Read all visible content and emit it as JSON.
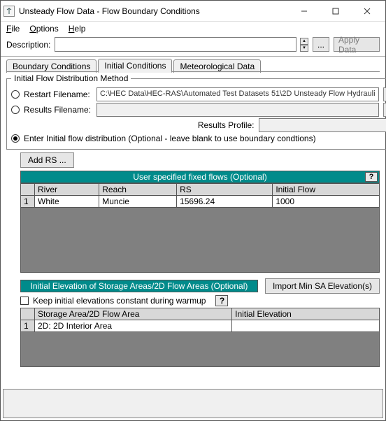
{
  "window": {
    "title": "Unsteady Flow Data - Flow Boundary Conditions"
  },
  "menu": {
    "file": "File",
    "options": "Options",
    "help": "Help"
  },
  "description": {
    "label": "Description:",
    "value": "",
    "ellipsis": "...",
    "apply": "Apply Data"
  },
  "tabs": {
    "boundary": "Boundary Conditions",
    "initial": "Initial Conditions",
    "met": "Meteorological Data"
  },
  "group": {
    "legend": "Initial Flow Distribution Method",
    "restart_label": "Restart Filename:",
    "restart_value": "C:\\HEC Data\\HEC-RAS\\Automated Test Datasets 51\\2D Unsteady Flow Hydrauli",
    "results_label": "Results Filename:",
    "results_value": "",
    "results_profile_label": "Results Profile:",
    "enter_label": "Enter Initial flow distribution (Optional - leave blank to use boundary condtions)"
  },
  "add_rs": "Add RS ...",
  "flows": {
    "header": "User specified fixed flows (Optional)",
    "help": "?",
    "cols": {
      "river": "River",
      "reach": "Reach",
      "rs": "RS",
      "flow": "Initial Flow"
    },
    "rows": [
      {
        "n": "1",
        "river": "White",
        "reach": "Muncie",
        "rs": "15696.24",
        "flow": "1000"
      }
    ]
  },
  "elev": {
    "header": "Initial Elevation of Storage Areas/2D Flow Areas (Optional)",
    "import_btn": "Import Min SA Elevation(s)",
    "keep_label": "Keep initial elevations constant during warmup",
    "help": "?",
    "cols": {
      "area": "Storage Area/2D Flow Area",
      "elev": "Initial Elevation"
    },
    "rows": [
      {
        "n": "1",
        "area": "2D: 2D Interior Area",
        "elev": ""
      }
    ]
  }
}
